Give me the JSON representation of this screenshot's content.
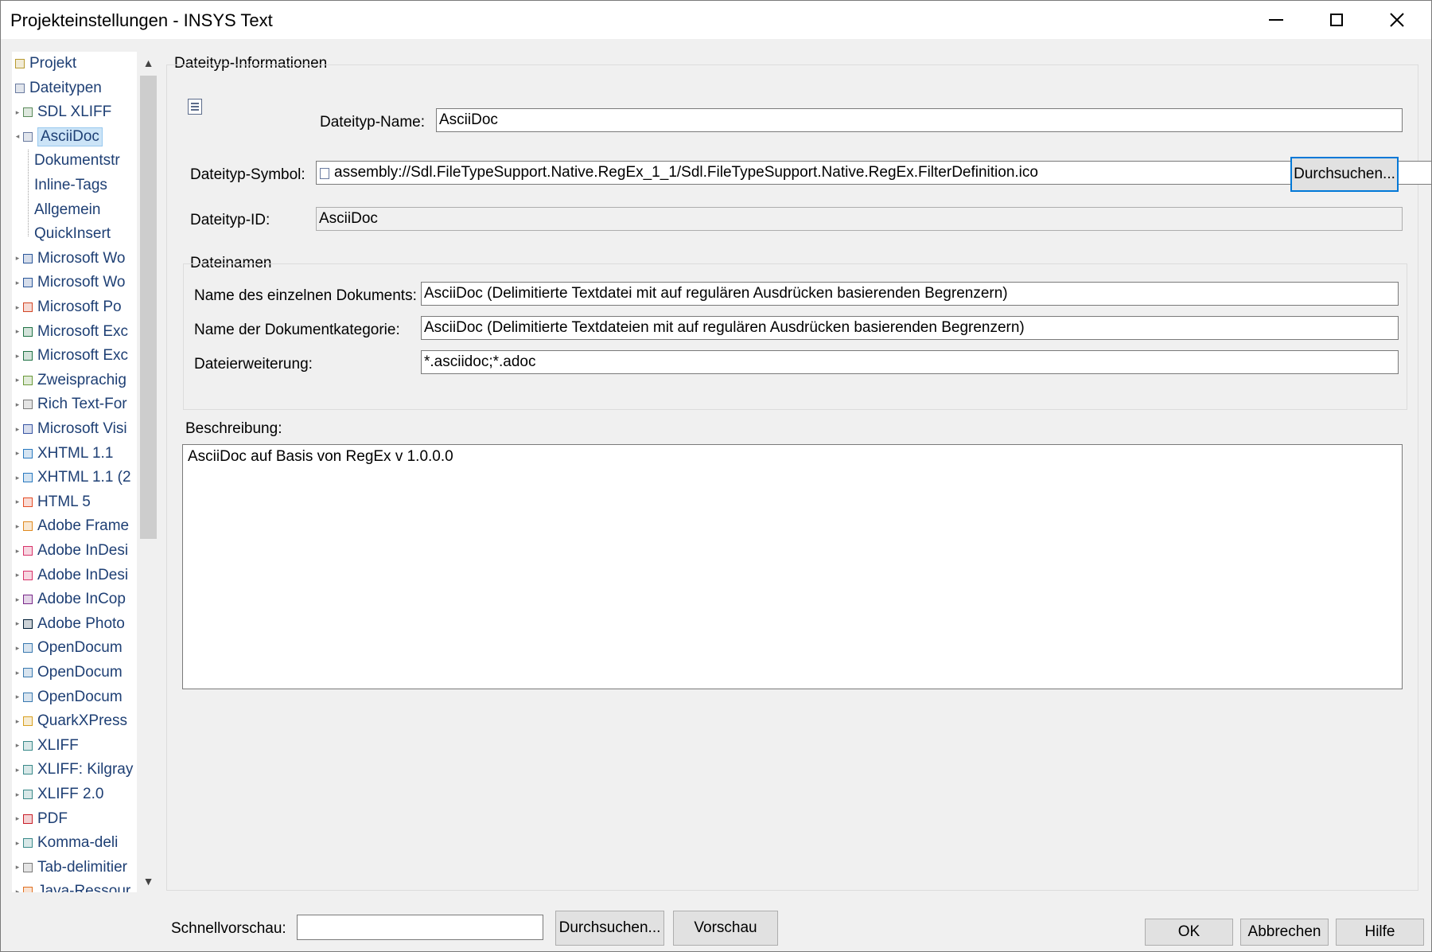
{
  "window": {
    "title": "Projekteinstellungen - INSYS Text"
  },
  "tree": {
    "items": [
      {
        "label": "Projekt",
        "color": "#b89a30"
      },
      {
        "label": "Dateitypen",
        "color": "#6a7ba0"
      },
      {
        "label": "SDL XLIFF",
        "color": "#5a8a5a"
      },
      {
        "label": "AsciiDoc",
        "color": "#6a7ba0",
        "selected": true
      },
      {
        "label": "Dokumentstr"
      },
      {
        "label": "Inline-Tags"
      },
      {
        "label": "Allgemein"
      },
      {
        "label": "QuickInsert"
      },
      {
        "label": "Microsoft Wo",
        "color": "#2b579a"
      },
      {
        "label": "Microsoft Wo",
        "color": "#2b579a"
      },
      {
        "label": "Microsoft Po",
        "color": "#d24726"
      },
      {
        "label": "Microsoft Exc",
        "color": "#217346"
      },
      {
        "label": "Microsoft Exc",
        "color": "#217346"
      },
      {
        "label": "Zweisprachig",
        "color": "#6a9a3a"
      },
      {
        "label": "Rich Text-For",
        "color": "#7a7a7a"
      },
      {
        "label": "Microsoft Visi",
        "color": "#3955a3"
      },
      {
        "label": "XHTML 1.1",
        "color": "#2a7ac0"
      },
      {
        "label": "XHTML 1.1 (2",
        "color": "#2a7ac0"
      },
      {
        "label": "HTML 5",
        "color": "#e44d26"
      },
      {
        "label": "Adobe Frame",
        "color": "#e08a20"
      },
      {
        "label": "Adobe InDesi",
        "color": "#d8336a"
      },
      {
        "label": "Adobe InDesi",
        "color": "#d8336a"
      },
      {
        "label": "Adobe InCop",
        "color": "#7a2a8a"
      },
      {
        "label": "Adobe Photo",
        "color": "#001e36"
      },
      {
        "label": "OpenDocum",
        "color": "#3a7ab0"
      },
      {
        "label": "OpenDocum",
        "color": "#3a7ab0"
      },
      {
        "label": "OpenDocum",
        "color": "#3a7ab0"
      },
      {
        "label": "QuarkXPress",
        "color": "#d8a020"
      },
      {
        "label": "XLIFF",
        "color": "#3a8a8a"
      },
      {
        "label": "XLIFF: Kilgray",
        "color": "#3a8a8a"
      },
      {
        "label": "XLIFF 2.0",
        "color": "#3a8a8a"
      },
      {
        "label": "PDF",
        "color": "#c8202a"
      },
      {
        "label": "Komma-deli",
        "color": "#3a8a8a"
      },
      {
        "label": "Tab-delimitier",
        "color": "#7a7a7a"
      },
      {
        "label": "Java-Ressour",
        "color": "#e07020"
      }
    ]
  },
  "panel": {
    "group_title": "Dateityp-Informationen",
    "name_label": "Dateityp-Name:",
    "name_value": "AsciiDoc",
    "symbol_label": "Dateityp-Symbol:",
    "symbol_value": "assembly://Sdl.FileTypeSupport.Native.RegEx_1_1/Sdl.FileTypeSupport.Native.RegEx.FilterDefinition.ico",
    "browse_label": "Durchsuchen...",
    "id_label": "Dateityp-ID:",
    "id_value": "AsciiDoc",
    "filenames_title": "Dateinamen",
    "single_doc_label": "Name des einzelnen Dokuments:",
    "single_doc_value": "AsciiDoc (Delimitierte Textdatei mit auf regulären Ausdrücken basierenden Begrenzern)",
    "category_label": "Name der Dokumentkategorie:",
    "category_value": "AsciiDoc (Delimitierte Textdateien mit auf regulären Ausdrücken basierenden Begrenzern)",
    "extension_label": "Dateierweiterung:",
    "extension_value": "*.asciidoc;*.adoc",
    "description_label": "Beschreibung:",
    "description_value": "AsciiDoc auf Basis von RegEx v 1.0.0.0"
  },
  "footer": {
    "preview_label": "Schnellvorschau:",
    "preview_value": "",
    "browse_label": "Durchsuchen...",
    "preview_button": "Vorschau",
    "ok": "OK",
    "cancel": "Abbrechen",
    "help": "Hilfe"
  }
}
